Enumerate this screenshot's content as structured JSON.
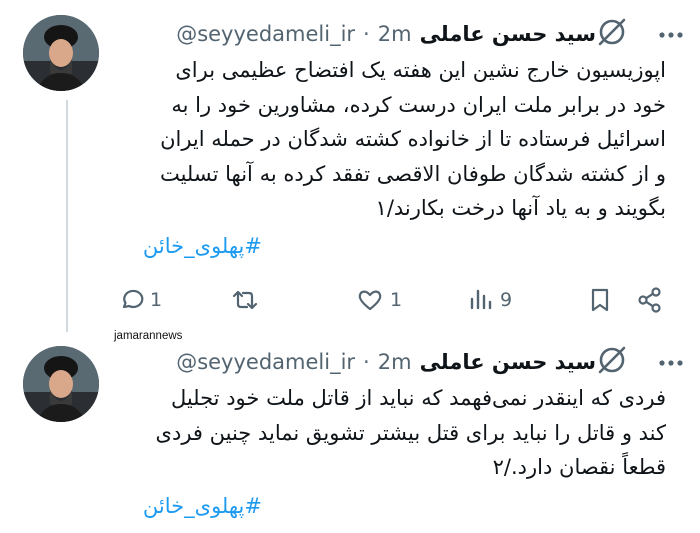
{
  "watermark": "jamarannews",
  "tweets": [
    {
      "author_name": "سید حسن عاملی",
      "handle": "@seyyedameli_ir",
      "separator": "·",
      "time": "2m",
      "text_lines": [
        "اپوزیسیون خارج نشین این هفته یک افتضاح عظیمی برای",
        "خود در برابر ملت ایران درست کرده، مشاورین خود را به",
        "اسرائیل فرستاده تا از خانواده کشته شدگان در حمله ایران",
        "و از کشته شدگان طوفان الاقصی تفقد کرده به آنها تسلیت",
        "بگویند و به یاد آنها درخت بکارند/۱"
      ],
      "hashtag": "#پهلوی_خائن",
      "replies": "1",
      "retweets": "",
      "likes": "1",
      "views": "9"
    },
    {
      "author_name": "سید حسن عاملی",
      "handle": "@seyyedameli_ir",
      "separator": "·",
      "time": "2m",
      "text_lines": [
        "فردی که اینقدر نمی‌فهمد که نباید از قاتل ملت خود تجلیل",
        "کند و قاتل را نباید برای قتل بیشتر تشویق نماید چنین فردی",
        "قطعاً نقصان دارد./۲"
      ],
      "hashtag": "#پهلوی_خائن"
    }
  ]
}
